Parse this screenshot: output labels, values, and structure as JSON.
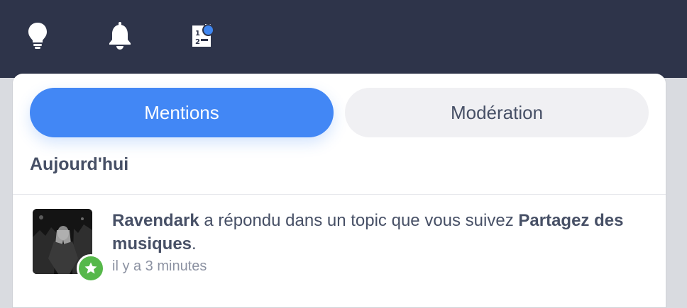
{
  "topbar": {
    "icons": [
      "lightbulb-icon",
      "bell-icon",
      "ranking-icon"
    ],
    "ranking_badge_color": "#3f86f0"
  },
  "tabs": [
    {
      "label": "Mentions",
      "active": true
    },
    {
      "label": "Modération",
      "active": false
    }
  ],
  "section": {
    "heading": "Aujourd'hui"
  },
  "notifications": [
    {
      "user": "Ravendark",
      "action": " a répondu dans un topic que vous suivez ",
      "topic": "Partagez des musiques",
      "end": ".",
      "time": "il y a 3 minutes",
      "badge_icon": "star-icon"
    }
  ],
  "colors": {
    "topbar": "#2e344a",
    "accent": "#4287f5",
    "badge_green": "#56b84a",
    "text": "#475066"
  }
}
